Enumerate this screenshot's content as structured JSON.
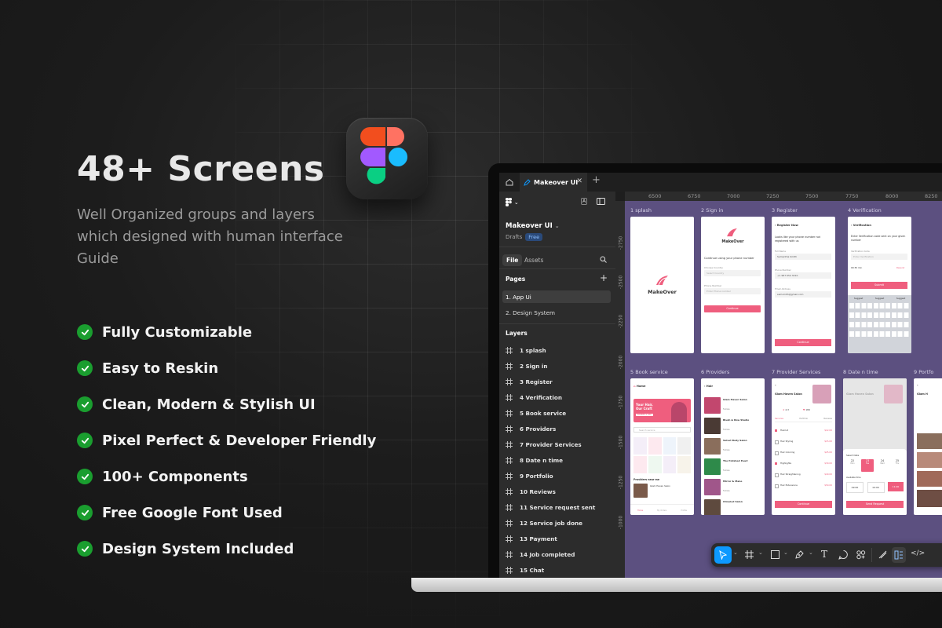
{
  "headline": "48+ Screens",
  "subtitle": "Well Organized groups and layers which designed with human interface Guide",
  "features": [
    "Fully Customizable",
    "Easy to Reskin",
    "Clean, Modern & Stylish UI",
    "Pixel Perfect & Developer Friendly",
    "100+ Components",
    "Free Google Font Used",
    "Design System Included"
  ],
  "figma": {
    "tab_title": "Makeover UI",
    "file_title": "Makeover UI",
    "drafts_label": "Drafts",
    "plan_badge": "Free",
    "tab_file": "File",
    "tab_assets": "Assets",
    "pages_title": "Pages",
    "pages": [
      "1. App Ui",
      "2. Design System"
    ],
    "layers_title": "Layers",
    "layers": [
      "1 splash",
      "2 Sign in",
      "3 Register",
      "4 Verification",
      "5 Book service",
      "6 Providers",
      "7 Provider Services",
      "8 Date n time",
      "9 Portfolio",
      "10 Reviews",
      "11 Service request sent",
      "12 Service job done",
      "13 Payment",
      "14 Job completed",
      "15 Chat"
    ],
    "ruler_top": [
      "6500",
      "6750",
      "7000",
      "7250",
      "7500",
      "7750",
      "8000",
      "8250"
    ],
    "ruler_left": [
      "-2750",
      "-2500",
      "-2250",
      "-2000",
      "-1750",
      "-1500",
      "-1250",
      "-1000"
    ],
    "frame_labels": [
      "1 splash",
      "2 Sign in",
      "3 Register",
      "4 Verification",
      "5 Book service",
      "6 Providers",
      "7 Provider Services",
      "8 Date n time",
      "9 Portfo"
    ],
    "colors": {
      "accent": "#0d99ff",
      "canvas": "#5c5080",
      "brand_pink": "#ef5e7e"
    }
  },
  "screens": {
    "splash_brand": "MakeOver",
    "signin_brand": "MakeOver",
    "signin_heading": "Continue using your phone number",
    "signin_country_label": "Choose Country",
    "signin_country_value": "Select Country",
    "signin_phone_label": "Phone Number",
    "signin_phone_value": "Enter Phone number",
    "signin_button": "Continue",
    "register_title": "Register Now",
    "register_heading": "Looks like your phone number not registered with us",
    "register_name_label": "Full Name",
    "register_name_value": "Samantha Smith",
    "register_phone_label": "Phone Number",
    "register_phone_value": "+1 987 654 3210",
    "register_email_label": "Email Address",
    "register_email_value": "samsmith@gmail.com",
    "register_button": "Continue",
    "verify_title": "Verification",
    "verify_heading": "Enter Verification code sent on your given number",
    "verify_code_label": "Verification Code",
    "verify_code_value": "Enter Verification",
    "verify_timer": "00:30 min",
    "verify_resend": "Resend",
    "verify_button": "Submit",
    "verify_suggest": [
      "Suggest",
      "Suggest",
      "Suggest"
    ],
    "book_home": "Home",
    "book_banner": "Your Hair, Our Craft",
    "book_banner_cta": "BARBER & SPA",
    "book_search": "Search service",
    "book_providers": "Providers near me",
    "book_provider_name": "Glam Haven Salon",
    "book_nav": [
      "Home",
      "My Orders",
      "Profile"
    ],
    "providers_title": "Hair",
    "providers": [
      {
        "name": "Glam Haven Salon",
        "type": "Female"
      },
      {
        "name": "Blush & Bow Studio",
        "type": "Female"
      },
      {
        "name": "Velvet Body Salon",
        "type": "Female"
      },
      {
        "name": "The Polished Pearl",
        "type": "Female"
      },
      {
        "name": "Mirror & Mane",
        "type": "Female"
      },
      {
        "name": "Chiseled Salon",
        "type": ""
      }
    ],
    "ps_name": "Glam Haven Salon",
    "ps_rating": "4.3",
    "ps_reviews": "189",
    "ps_tabs": [
      "Services",
      "Portfolio",
      "Reviews"
    ],
    "ps_services": [
      {
        "name": "Haircut",
        "price": "$12.00",
        "checked": true
      },
      {
        "name": "Hair Styling",
        "price": "$15.00",
        "checked": false
      },
      {
        "name": "Hair Coloring",
        "price": "$25.00",
        "checked": false
      },
      {
        "name": "Highlights",
        "price": "$30.00",
        "checked": true
      },
      {
        "name": "Hair Straightening",
        "price": "$40.00",
        "checked": false
      },
      {
        "name": "Hair Extensions",
        "price": "$50.00",
        "checked": false
      }
    ],
    "ps_button": "Continue",
    "dt_name": "Glam Haven Salon",
    "dt_select_date": "Select Date",
    "dt_dates": [
      "22",
      "23",
      "24",
      "25"
    ],
    "dt_days": [
      "Mon",
      "Tue",
      "Wed",
      "Thu"
    ],
    "dt_slot_label": "Available time",
    "dt_times": [
      "09:00",
      "10:00",
      "11:00"
    ],
    "dt_button": "Send Request",
    "portfolio_name": "Glam H"
  }
}
